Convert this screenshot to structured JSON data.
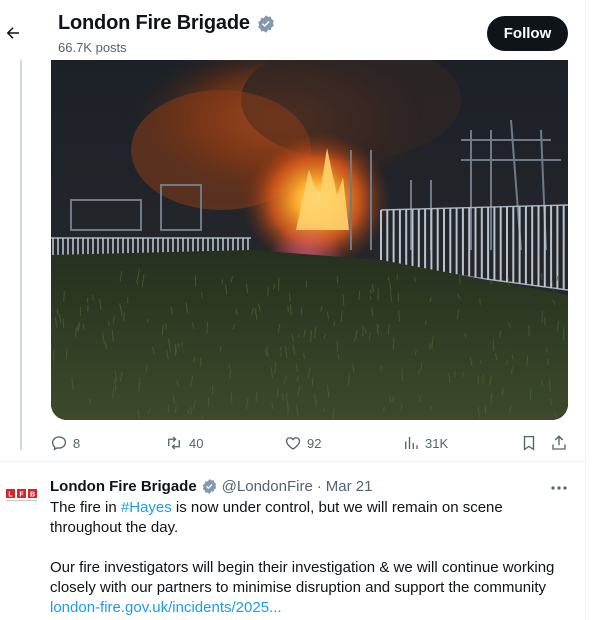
{
  "header": {
    "back_icon": "arrow-left-icon",
    "title": "London Fire Brigade",
    "verified_icon": "verified-badge-icon",
    "post_count": "66.7K posts",
    "follow_label": "Follow"
  },
  "media": {
    "kind": "photo"
  },
  "actions": {
    "replies": "8",
    "reposts": "40",
    "likes": "92",
    "views": "31K",
    "icons": [
      "reply-icon",
      "repost-icon",
      "like-icon",
      "views-icon",
      "bookmark-icon",
      "share-icon"
    ]
  },
  "tweet": {
    "avatar_text": "LFB",
    "name": "London Fire Brigade",
    "handle": "@LondonFire",
    "separator": "·",
    "date": "Mar 21",
    "text_before_hashtag": "The fire in ",
    "hashtag": "#Hayes",
    "text_after_hashtag": " is now under control, but we will remain on scene throughout the day.",
    "paragraph2": "Our fire investigators will begin their investigation & we will continue working closely with our partners to minimise disruption and support the community ",
    "link": "london-fire.gov.uk/incidents/2025..."
  },
  "colors": {
    "accent": "#1d9bf0",
    "text": "#0f1419",
    "muted": "#536471",
    "brand_red": "#d8232a"
  }
}
